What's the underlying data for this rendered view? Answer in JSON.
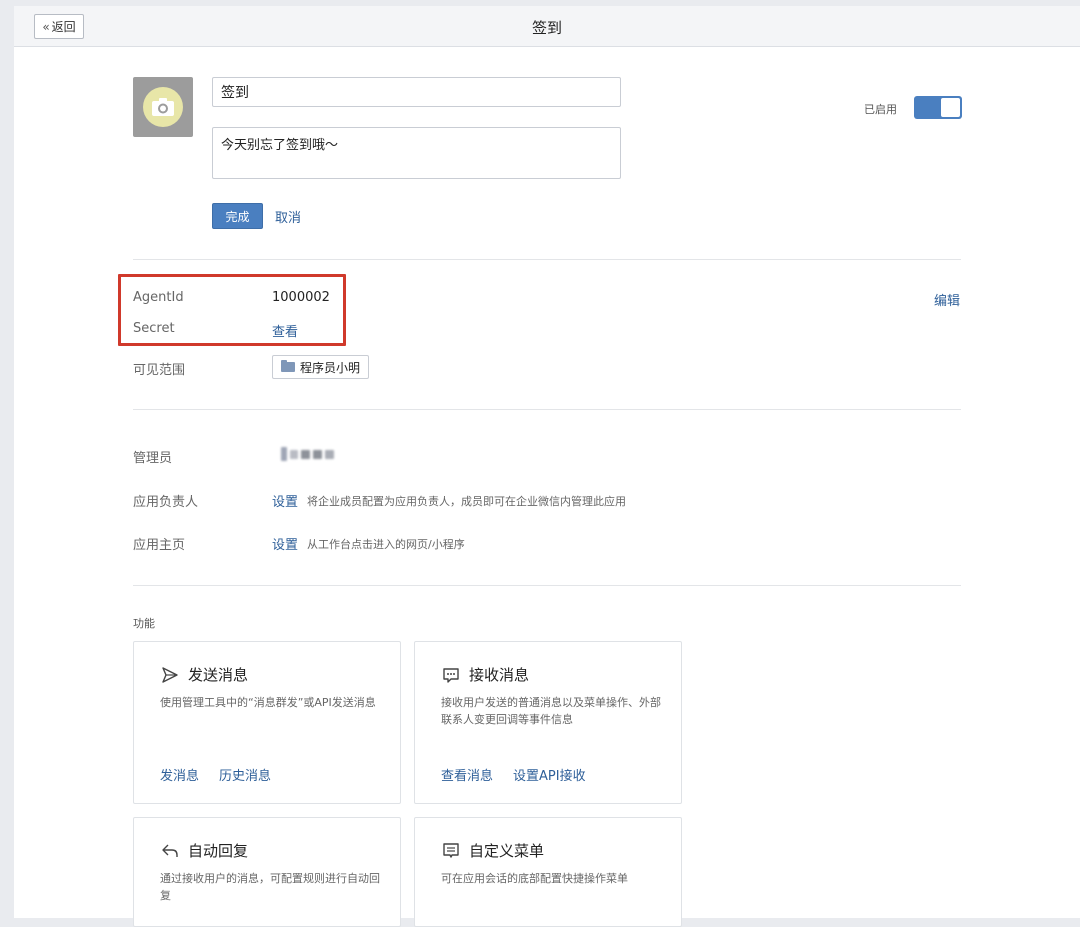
{
  "header": {
    "back_label": "返回",
    "title": "签到"
  },
  "app": {
    "name": "签到",
    "description": "今天别忘了签到哦～",
    "done_label": "完成",
    "cancel_label": "取消",
    "enabled_label": "已启用",
    "enabled": true
  },
  "credentials": {
    "agentid_label": "AgentId",
    "agentid_value": "1000002",
    "secret_label": "Secret",
    "secret_link": "查看",
    "edit_link": "编辑",
    "scope_label": "可见范围",
    "scope_value": "程序员小明"
  },
  "management": {
    "admin_label": "管理员",
    "owner_label": "应用负责人",
    "owner_link": "设置",
    "owner_hint": "将企业成员配置为应用负责人，成员即可在企业微信内管理此应用",
    "homepage_label": "应用主页",
    "homepage_link": "设置",
    "homepage_hint": "从工作台点击进入的网页/小程序"
  },
  "features": {
    "section_title": "功能",
    "cards": [
      {
        "icon": "send-icon",
        "title": "发送消息",
        "desc": "使用管理工具中的“消息群发”或API发送消息",
        "links": [
          "发消息",
          "历史消息"
        ]
      },
      {
        "icon": "chat-icon",
        "title": "接收消息",
        "desc": "接收用户发送的普通消息以及菜单操作、外部联系人变更回调等事件信息",
        "links": [
          "查看消息",
          "设置API接收"
        ]
      },
      {
        "icon": "reply-icon",
        "title": "自动回复",
        "desc": "通过接收用户的消息，可配置规则进行自动回复",
        "links": []
      },
      {
        "icon": "menu-icon",
        "title": "自定义菜单",
        "desc": "可在应用会话的底部配置快捷操作菜单",
        "links": []
      }
    ]
  },
  "colors": {
    "accent": "#4a7fc0",
    "link": "#2e5f99",
    "highlight": "#d0392b"
  }
}
